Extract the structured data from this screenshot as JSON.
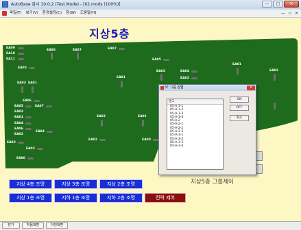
{
  "window": {
    "title": "AutoBase 감시 10.0.2 (Test Mode) - [02.mods (100%)]",
    "buttons": [
      "—",
      "□",
      "✕"
    ]
  },
  "menu": {
    "items": [
      "파일(F)",
      "보기(V)",
      "환경설정(C)",
      "창(W)",
      "도움말(H)"
    ],
    "mdi_controls": [
      "—",
      "▫",
      "✕"
    ]
  },
  "floor_title": "지상5층",
  "map": {
    "fill_color": "#1e6b1e",
    "labels": [
      "EA09",
      "EA10",
      "EA11",
      "EA05",
      "EA06",
      "EA07",
      "EA07",
      "EA03",
      "EA01",
      "EA06",
      "EA05",
      "EA07",
      "EA03",
      "EA01",
      "EA04",
      "EA06",
      "EA04",
      "EA02",
      "EA02",
      "EA03",
      "EA06",
      "EA02",
      "EA02",
      "EA01",
      "EA01",
      "EA00",
      "EA05",
      "EA03",
      "EA04",
      "EA02",
      "EA01",
      "EA02"
    ]
  },
  "controls": {
    "row1": [
      "지상 4층 조명",
      "지상  3층 조명",
      "지상 2층 조명"
    ],
    "row2": [
      "지상 1층 조명",
      "지하 1층 조명",
      "지하 2층 조명",
      "전력 제어"
    ],
    "group_label": "지상5층 그룹제어"
  },
  "dialog": {
    "title": "5F 그룹 점멸",
    "list_header": "명그",
    "items": [
      "05-A-1-1",
      "05-A-1-2",
      "05-A-1-3",
      "05-A-1-4",
      "05-A-2",
      "05-A-2-1",
      "05-A-2-2",
      "05-A-2-3",
      "05-A-3-1",
      "05-A-3-2",
      "05-A-3-3",
      "05-A-3-4"
    ],
    "buttons": {
      "on": "ON",
      "off": "OFF",
      "cancel": "취소"
    }
  },
  "statusbar": {
    "buttons": [
      "닫기",
      "처음화면",
      "이전화면"
    ]
  },
  "colors": {
    "button_blue": "#1a2ed8",
    "button_red": "#8a1010",
    "background": "#fdf7c4"
  }
}
